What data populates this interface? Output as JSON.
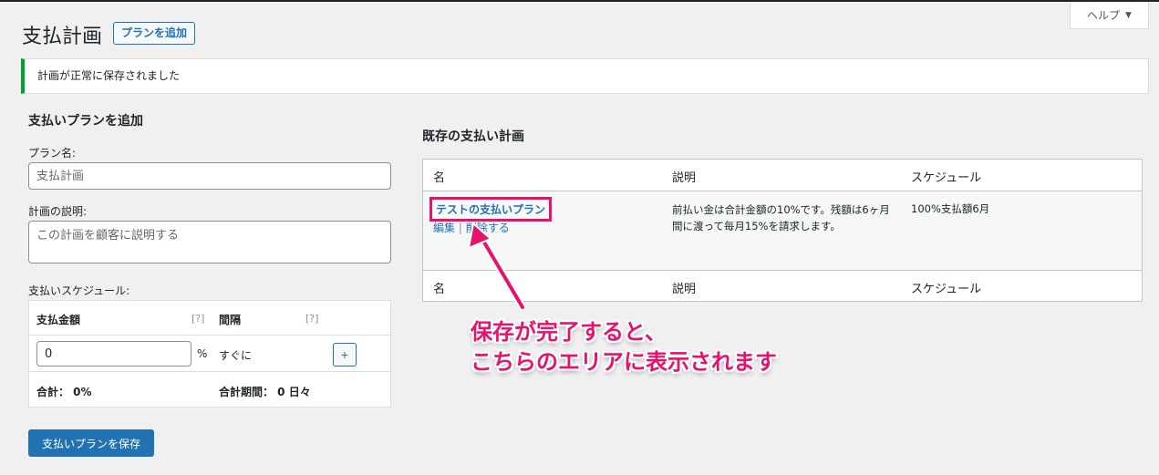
{
  "header": {
    "title": "支払計画",
    "add_button": "プランを追加",
    "help_tab": "ヘルプ"
  },
  "notice": {
    "message": "計画が正常に保存されました"
  },
  "form": {
    "section_title": "支払いプランを追加",
    "plan_name_label": "プラン名:",
    "plan_name_placeholder": "支払計画",
    "desc_label": "計画の説明:",
    "desc_placeholder": "この計画を顧客に説明する",
    "schedule_label": "支払いスケジュール:",
    "schedule": {
      "amount_header": "支払金額",
      "interval_header": "間隔",
      "hint": "[?]",
      "amount_value": "0",
      "percent_symbol": "%",
      "interval_value": "すぐに",
      "add_symbol": "+",
      "total_label": "合計： 0%",
      "total_period_label": "合計期間： 0 日々"
    },
    "save_button": "支払いプランを保存"
  },
  "existing": {
    "section_title": "既存の支払い計画",
    "columns": [
      "名",
      "説明",
      "スケジュール"
    ],
    "rows": [
      {
        "name": "テストの支払いプラン",
        "edit": "編集",
        "separator": "|",
        "delete": "削除する",
        "description": "前払い金は合計金額の10%です。残額は6ヶ月間に渡って毎月15%を請求します。",
        "schedule": "100%支払額6月"
      }
    ]
  },
  "annotation": {
    "line1": "保存が完了すると、",
    "line2": "こちらのエリアに表示されます",
    "color": "#e6126c"
  }
}
